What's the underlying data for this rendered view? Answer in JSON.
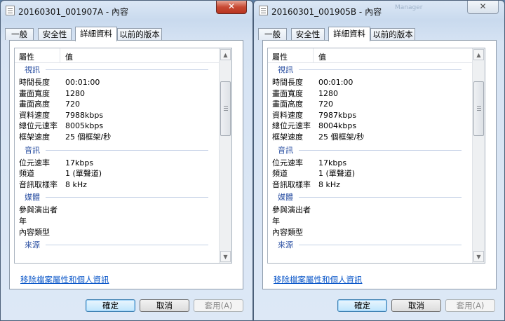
{
  "windows": [
    {
      "title": "20160301_001907A - 內容",
      "ghost_text": "",
      "tabs": [
        "一般",
        "安全性",
        "詳細資料",
        "以前的版本"
      ],
      "active_tab": "詳細資料",
      "columns": {
        "property": "屬性",
        "value": "值"
      },
      "groups": [
        {
          "name": "視訊",
          "rows": [
            {
              "label": "時間長度",
              "value": "00:01:00"
            },
            {
              "label": "畫面寬度",
              "value": "1280"
            },
            {
              "label": "畫面高度",
              "value": "720"
            },
            {
              "label": "資料速度",
              "value": "7988kbps"
            },
            {
              "label": "總位元速率",
              "value": "8005kbps"
            },
            {
              "label": "框架速度",
              "value": "25 個框架/秒"
            }
          ]
        },
        {
          "name": "音訊",
          "rows": [
            {
              "label": "位元速率",
              "value": "17kbps"
            },
            {
              "label": "頻道",
              "value": "1 (單聲道)"
            },
            {
              "label": "音訊取樣率",
              "value": "8 kHz"
            }
          ]
        },
        {
          "name": "媒體",
          "rows": [
            {
              "label": "參與演出者",
              "value": ""
            },
            {
              "label": "年",
              "value": ""
            },
            {
              "label": "內容類型",
              "value": ""
            }
          ]
        },
        {
          "name": "來源",
          "rows": []
        }
      ],
      "remove_link": "移除檔案屬性和個人資訊",
      "buttons": {
        "ok": "確定",
        "cancel": "取消",
        "apply": "套用(A)"
      }
    },
    {
      "title": "20160301_001905B - 內容",
      "ghost_text": "Manager",
      "tabs": [
        "一般",
        "安全性",
        "詳細資料",
        "以前的版本"
      ],
      "active_tab": "詳細資料",
      "columns": {
        "property": "屬性",
        "value": "值"
      },
      "groups": [
        {
          "name": "視訊",
          "rows": [
            {
              "label": "時間長度",
              "value": "00:01:00"
            },
            {
              "label": "畫面寬度",
              "value": "1280"
            },
            {
              "label": "畫面高度",
              "value": "720"
            },
            {
              "label": "資料速度",
              "value": "7987kbps"
            },
            {
              "label": "總位元速率",
              "value": "8004kbps"
            },
            {
              "label": "框架速度",
              "value": "25 個框架/秒"
            }
          ]
        },
        {
          "name": "音訊",
          "rows": [
            {
              "label": "位元速率",
              "value": "17kbps"
            },
            {
              "label": "頻道",
              "value": "1 (單聲道)"
            },
            {
              "label": "音訊取樣率",
              "value": "8 kHz"
            }
          ]
        },
        {
          "name": "媒體",
          "rows": [
            {
              "label": "參與演出者",
              "value": ""
            },
            {
              "label": "年",
              "value": ""
            },
            {
              "label": "內容類型",
              "value": ""
            }
          ]
        },
        {
          "name": "來源",
          "rows": []
        }
      ],
      "remove_link": "移除檔案屬性和個人資訊",
      "buttons": {
        "ok": "確定",
        "cancel": "取消",
        "apply": "套用(A)"
      }
    }
  ]
}
